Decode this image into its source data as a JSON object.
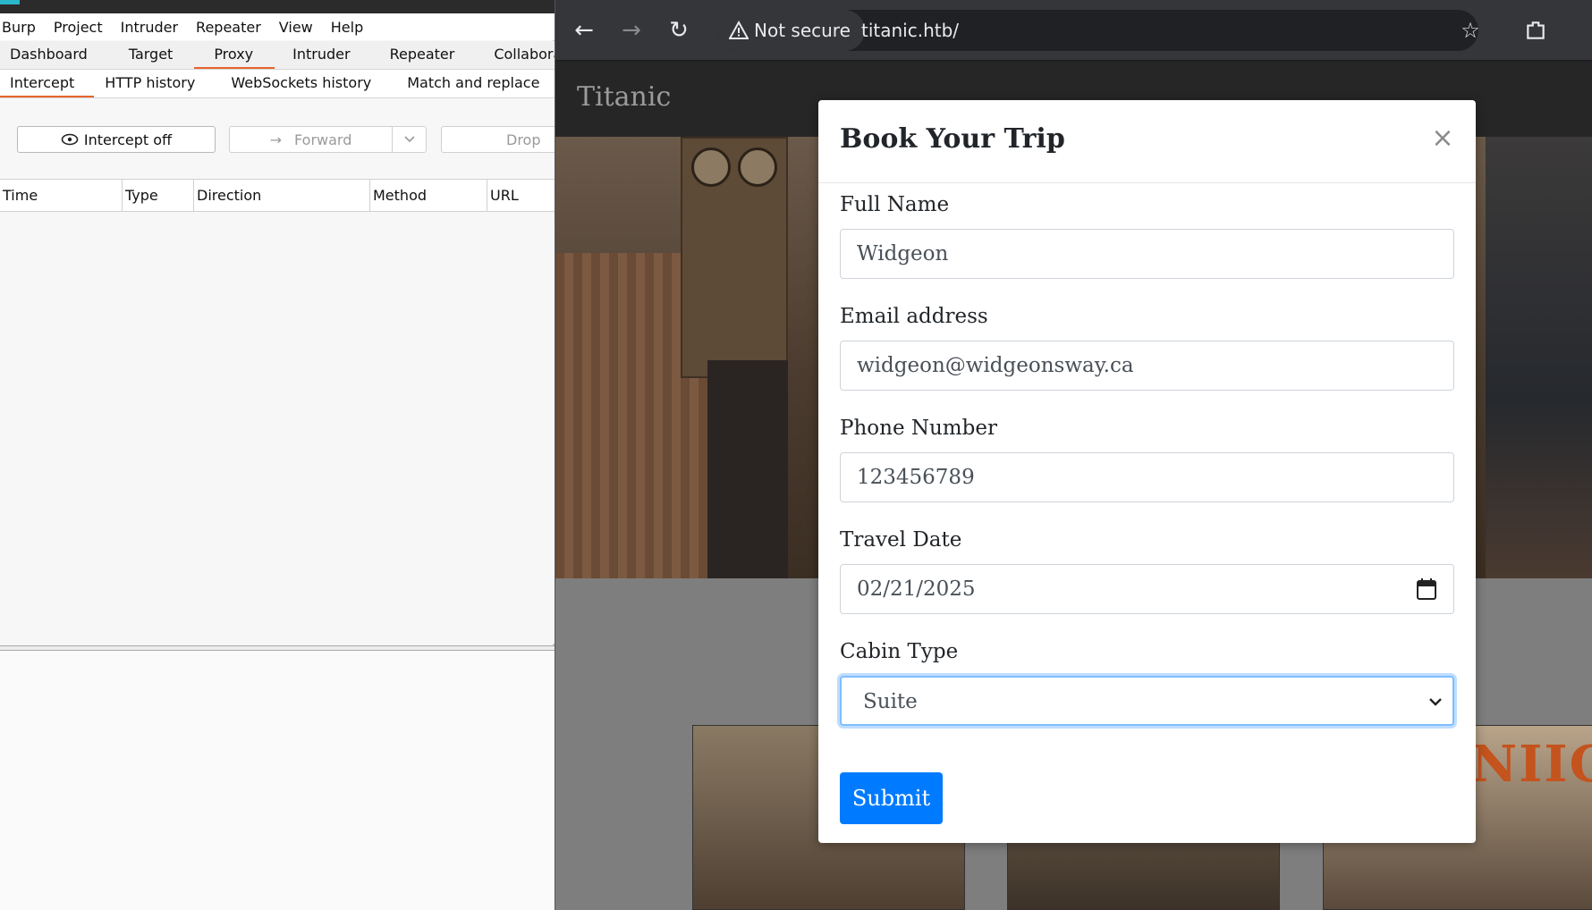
{
  "burp": {
    "menu": [
      "Burp",
      "Project",
      "Intruder",
      "Repeater",
      "View",
      "Help"
    ],
    "main_tabs": [
      "Dashboard",
      "Target",
      "Proxy",
      "Intruder",
      "Repeater",
      "Collaborato"
    ],
    "sub_tabs": [
      "Intercept",
      "HTTP history",
      "WebSockets history",
      "Match and replace"
    ],
    "intercept_label": "Intercept off",
    "forward_label": "Forward",
    "drop_label": "Drop",
    "columns": [
      "Time",
      "Type",
      "Direction",
      "Method",
      "URL"
    ]
  },
  "browser": {
    "security_label": "Not secure",
    "url": "titanic.htb/",
    "site_brand": "Titanic",
    "gallery_banner": "NIIC"
  },
  "modal": {
    "title": "Book Your Trip",
    "fields": {
      "full_name_label": "Full Name",
      "full_name_value": "Widgeon",
      "email_label": "Email address",
      "email_value": "widgeon@widgeonsway.ca",
      "phone_label": "Phone Number",
      "phone_value": "123456789",
      "date_label": "Travel Date",
      "date_value": "02/21/2025",
      "cabin_label": "Cabin Type",
      "cabin_value": "Suite"
    },
    "submit_label": "Submit"
  },
  "colors": {
    "burp_accent": "#e8642c",
    "submit_blue": "#007bff",
    "focus_ring": "#80bdff"
  }
}
